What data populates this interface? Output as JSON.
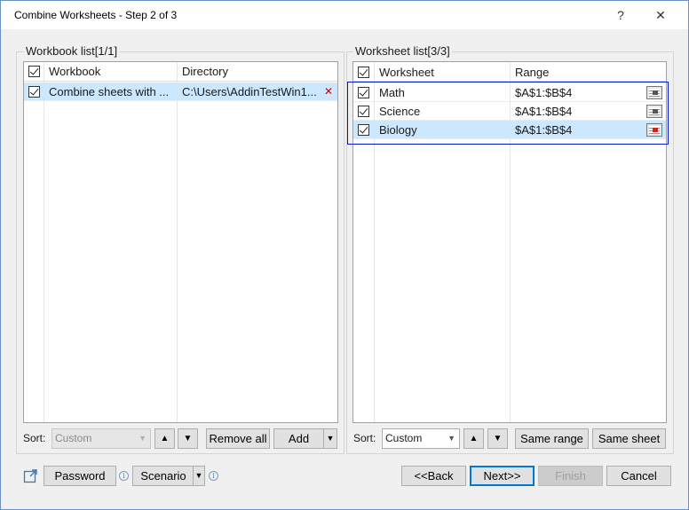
{
  "window": {
    "title": "Combine Worksheets - Step 2 of 3",
    "help_glyph": "?",
    "close_glyph": "✕"
  },
  "workbook_list": {
    "label": "Workbook list[1/1]",
    "columns": {
      "name": "Workbook",
      "directory": "Directory"
    },
    "rows": [
      {
        "name": "Combine sheets with ...",
        "directory": "C:\\Users\\AddinTestWin1...",
        "remove_glyph": "✕"
      }
    ],
    "sort_label": "Sort:",
    "sort_value": "Custom",
    "up_glyph": "▲",
    "down_glyph": "▼",
    "remove_all": "Remove all",
    "add": "Add",
    "add_arrow": "▼"
  },
  "worksheet_list": {
    "label": "Worksheet list[3/3]",
    "columns": {
      "name": "Worksheet",
      "range": "Range"
    },
    "rows": [
      {
        "name": "Math",
        "range": "$A$1:$B$4"
      },
      {
        "name": "Science",
        "range": "$A$1:$B$4"
      },
      {
        "name": "Biology",
        "range": "$A$1:$B$4"
      }
    ],
    "sort_label": "Sort:",
    "sort_value": "Custom",
    "up_glyph": "▲",
    "down_glyph": "▼",
    "same_range": "Same range",
    "same_sheet": "Same sheet"
  },
  "footer": {
    "password": "Password",
    "scenario": "Scenario",
    "scenario_arrow": "▼",
    "info_glyph": "i",
    "back": "<<Back",
    "next": "Next>>",
    "finish": "Finish",
    "cancel": "Cancel"
  },
  "colors": {
    "selection": "#cce8ff",
    "highlight_box": "#0016c9",
    "remove_red": "#d40000"
  }
}
